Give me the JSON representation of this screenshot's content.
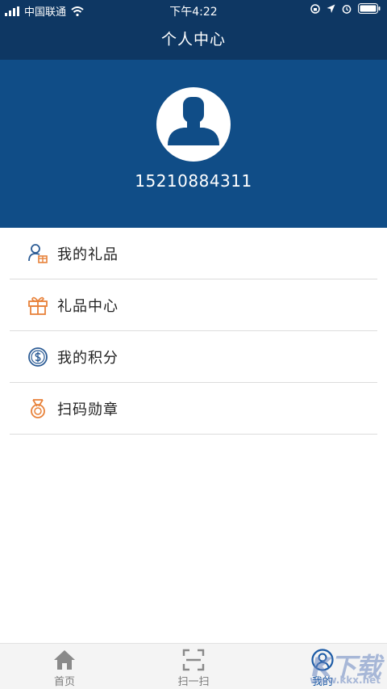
{
  "status_bar": {
    "carrier": "中国联通",
    "time": "下午4:22"
  },
  "header": {
    "title": "个人中心"
  },
  "profile": {
    "phone": "15210884311"
  },
  "menu": {
    "items": [
      {
        "label": "我的礼品",
        "icon": "user-gift-icon",
        "color": "#2c5c95"
      },
      {
        "label": "礼品中心",
        "icon": "gift-box-icon",
        "color": "#e8823a"
      },
      {
        "label": "我的积分",
        "icon": "coin-icon",
        "color": "#2c5c95"
      },
      {
        "label": "扫码勋章",
        "icon": "medal-icon",
        "color": "#e8823a"
      }
    ]
  },
  "tab_bar": {
    "tabs": [
      {
        "label": "首页",
        "icon": "home-icon",
        "active": false
      },
      {
        "label": "扫一扫",
        "icon": "scan-icon",
        "active": false
      },
      {
        "label": "我的",
        "icon": "profile-icon",
        "active": true
      }
    ]
  },
  "watermark": {
    "logo": "K下载",
    "url": "www.kkx.net"
  },
  "colors": {
    "header_bg": "#0e3763",
    "profile_bg": "#104d87",
    "tab_active": "#1b5aa5",
    "tab_inactive": "#8a8a8a"
  }
}
